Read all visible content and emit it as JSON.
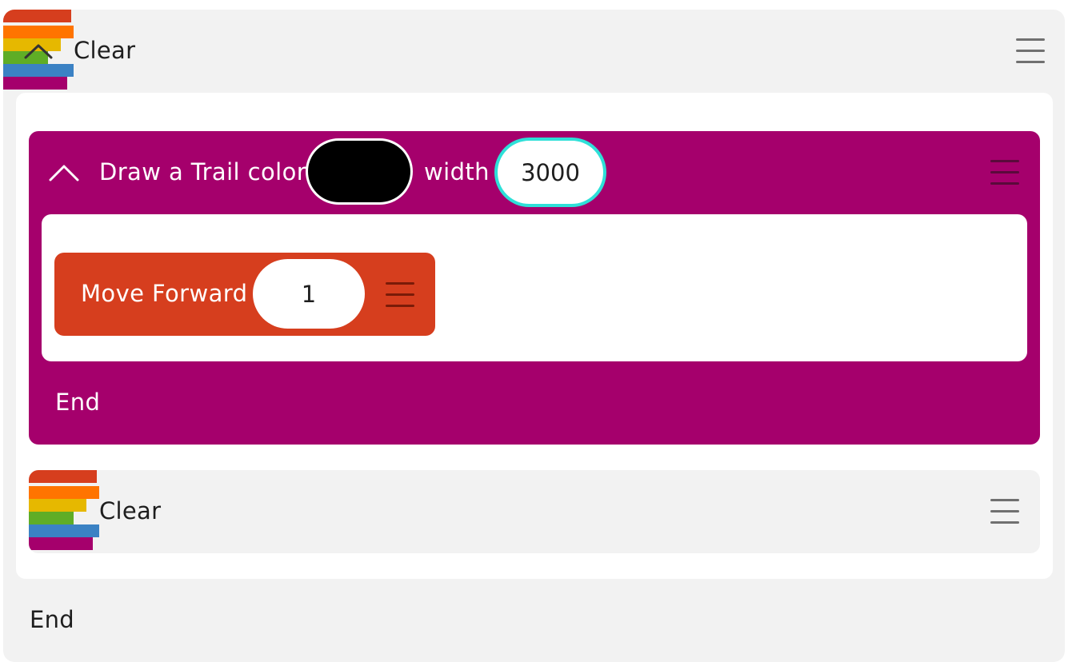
{
  "outer_block": {
    "label": "Clear",
    "end_label": "End",
    "collapse_icon": "chevron-up-icon",
    "menu_icon": "hamburger-menu-icon"
  },
  "trail_block": {
    "title_prefix": "Draw a Trail color",
    "width_label": "width",
    "color_value": "#000000",
    "width_value": "3000",
    "end_label": "End",
    "collapse_icon": "chevron-up-icon",
    "menu_icon": "hamburger-menu-icon"
  },
  "move_block": {
    "label": "Move Forward",
    "value": "1",
    "menu_icon": "hamburger-menu-icon"
  },
  "inner_clear_block": {
    "label": "Clear",
    "menu_icon": "hamburger-menu-icon"
  },
  "colors": {
    "block_bg": "#f2f2f2",
    "trail_magenta": "#a5006c",
    "move_orange": "#d63e1e",
    "focus_cyan": "#2ee0d8",
    "rainbow": [
      "#d63e1e",
      "#ff7400",
      "#e6b800",
      "#5fad26",
      "#3b82c4",
      "#a5006c"
    ]
  }
}
